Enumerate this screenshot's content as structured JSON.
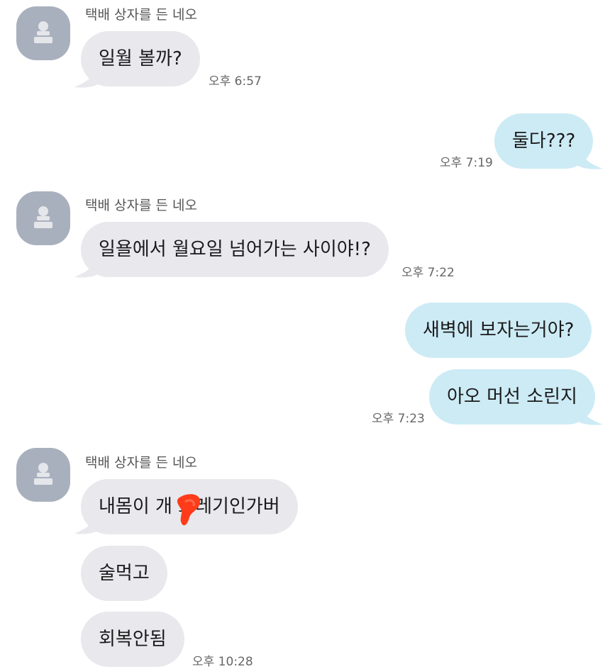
{
  "colors": {
    "incoming_bubble": "#e8e8ed",
    "outgoing_bubble": "#cdebf5",
    "avatar_bg": "#a9b0bd",
    "redaction": "#ff3b1a"
  },
  "messages": [
    {
      "sender": "택배 상자를 든 네오",
      "text": "일월 볼까?",
      "time": "오후 6:57",
      "direction": "incoming"
    },
    {
      "text": "둘다???",
      "time": "오후 7:19",
      "direction": "outgoing"
    },
    {
      "sender": "택배 상자를 든 네오",
      "text": "일욜에서 월요일 넘어가는 사이야!?",
      "time": "오후 7:22",
      "direction": "incoming"
    },
    {
      "text": "새벽에 보자는거야?",
      "direction": "outgoing"
    },
    {
      "text": "아오 머선 소린지",
      "time": "오후 7:23",
      "direction": "outgoing"
    },
    {
      "sender": "택배 상자를 든 네오",
      "text": "내몸이 개  쓰레기인가버",
      "direction": "incoming",
      "redacted": true
    },
    {
      "text": "술먹고",
      "direction": "incoming"
    },
    {
      "text": "회복안됨",
      "time": "오후 10:28",
      "direction": "incoming"
    }
  ]
}
